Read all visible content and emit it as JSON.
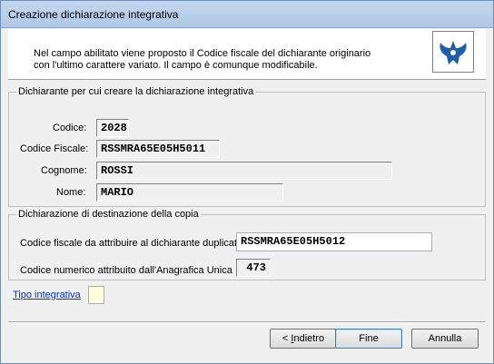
{
  "window": {
    "title": "Creazione dichiarazione integrativa"
  },
  "header": {
    "info_line1": "Nel campo abilitato viene proposto il Codice fiscale del dichiarante originario",
    "info_line2": "con l'ultimo carattere variato. Il campo è comunque modificabile.",
    "logo_icon": "blue-bird-icon",
    "colors": {
      "logo_blue": "#1e5fa8"
    }
  },
  "dichiarante": {
    "legend": "Dichiarante per cui creare la dichiarazione integrativa",
    "codice_label": "Codice:",
    "codice_value": "2028",
    "cf_label": "Codice Fiscale:",
    "cf_value": "RSSMRA65E05H5011",
    "cognome_label": "Cognome:",
    "cognome_value": "ROSSI",
    "nome_label": "Nome:",
    "nome_value": "MARIO"
  },
  "destinazione": {
    "legend": "Dichiarazione di destinazione della copia",
    "cf_dup_label": "Codice fiscale da attribuire al dichiarante duplicato",
    "cf_dup_value": "RSSMRA65E05H5012",
    "codnum_label": "Codice numerico attribuito dall'Anagrafica Unica",
    "codnum_value": "473"
  },
  "tipo_integrativa": {
    "label": "Tipo integrativa",
    "value": ""
  },
  "buttons": {
    "back_prefix": "< ",
    "back_mnemonic": "I",
    "back_rest": "ndietro",
    "finish": "Fine",
    "cancel": "Annulla"
  }
}
